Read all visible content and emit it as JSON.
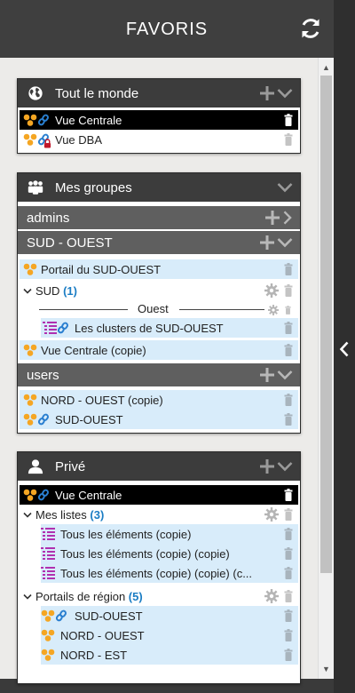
{
  "header": {
    "title": "FAVORIS",
    "refresh_icon": "refresh-icon"
  },
  "panels": {
    "world": {
      "title": "Tout le monde",
      "rows": [
        {
          "label": "Vue Centrale"
        },
        {
          "label": "Vue DBA"
        }
      ]
    },
    "groups": {
      "title": "Mes groupes",
      "admins": {
        "label": "admins"
      },
      "sud_ouest": {
        "label": "SUD - OUEST",
        "portail": "Portail du SUD-OUEST",
        "sud": "SUD",
        "sud_count": "(1)",
        "ouest_sep": "Ouest",
        "clusters": "Les clusters de SUD-OUEST",
        "vue_copie": "Vue Centrale (copie)"
      },
      "users": {
        "label": "users",
        "rows": [
          {
            "label": "NORD - OUEST (copie)"
          },
          {
            "label": "SUD-OUEST"
          }
        ]
      }
    },
    "private": {
      "title": "Privé",
      "vue": "Vue Centrale",
      "lists": {
        "label": "Mes listes",
        "count": "(3)",
        "items": [
          "Tous les éléments (copie)",
          "Tous les éléments (copie) (copie)",
          "Tous les éléments (copie) (copie) (c..."
        ]
      },
      "regions": {
        "label": "Portails de région",
        "count": "(5)",
        "items": [
          "SUD-OUEST",
          "NORD - OUEST",
          "NORD - EST"
        ]
      }
    }
  },
  "colors": {
    "accent": "#1b7dc4",
    "selection": "#d8ecfa",
    "header": "#3c3c3c",
    "icon_orange": "#f5a623",
    "list_magenta": "#b030b0"
  }
}
